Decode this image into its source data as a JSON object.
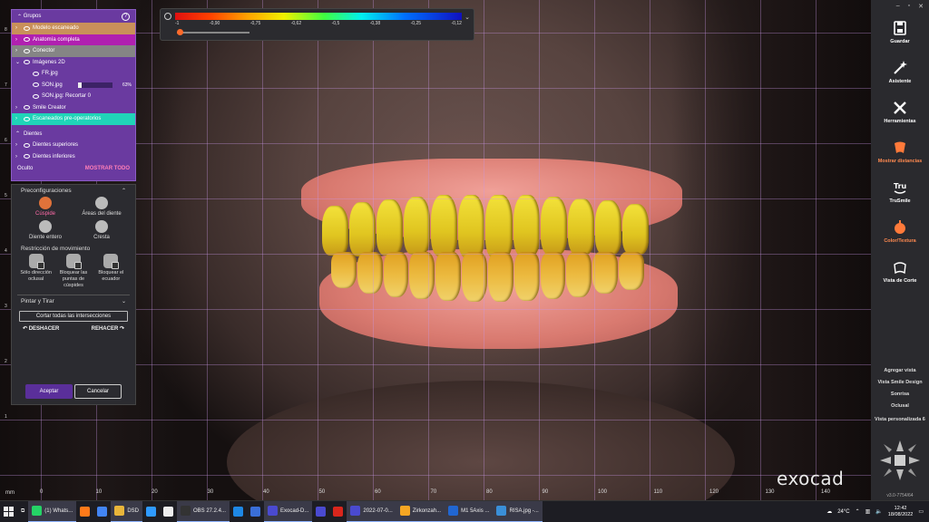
{
  "scale": {
    "labels": [
      "-1",
      "-0,90",
      "-0,75",
      "-0,62",
      "-0,5",
      "-0,38",
      "-0,25",
      "-0,12"
    ]
  },
  "groups": {
    "title": "Grupos",
    "rows": [
      {
        "label": "Modelo escaneado",
        "color": "#c9905a",
        "indent": 0,
        "chev": "›"
      },
      {
        "label": "Anatomía completa",
        "color": "#b020b0",
        "indent": 0,
        "chev": "›"
      },
      {
        "label": "Conector",
        "color": "#858585",
        "indent": 0,
        "chev": "›"
      },
      {
        "label": "Imágenes 2D",
        "color": "",
        "indent": 0,
        "chev": "⌄"
      },
      {
        "label": "FR.jpg",
        "color": "",
        "indent": 1,
        "chev": ""
      },
      {
        "label": "SON.jpg",
        "color": "",
        "indent": 1,
        "chev": "",
        "opacity": "63%"
      },
      {
        "label": "SON.jpg: Recortar 0",
        "color": "",
        "indent": 1,
        "chev": ""
      },
      {
        "label": "Smile Creator",
        "color": "",
        "indent": 0,
        "chev": "›"
      },
      {
        "label": "Escaneados pre-operatorios",
        "color": "#20d4b8",
        "indent": 0,
        "chev": "›"
      }
    ],
    "teeth_title": "Dientes",
    "teeth_rows": [
      "Dientes superiores",
      "Dientes inferiores"
    ],
    "hidden_label": "Oculto",
    "show_all": "MOSTRAR TODO"
  },
  "tools": {
    "presets_title": "Preconfiguraciones",
    "presets": [
      "Cúspide",
      "Áreas del diente",
      "Diente entero",
      "Cresta"
    ],
    "movement_title": "Restricción de movimiento",
    "movements": [
      "Sólo dirección oclusal",
      "Bloquear las puntas de cúspides",
      "Bloquear el ecuador"
    ],
    "paint_title": "Pintar y Tirar",
    "cut_all": "Cortar todas las intersecciones",
    "undo": "DESHACER",
    "redo": "REHACER",
    "accept": "Aceptar",
    "cancel": "Cancelar"
  },
  "ruler": {
    "unit": "mm",
    "ticks": [
      "0",
      "10",
      "20",
      "30",
      "40",
      "50",
      "60",
      "70",
      "80",
      "90",
      "100",
      "110",
      "120",
      "130",
      "140"
    ],
    "vticks": [
      "8",
      "7",
      "6",
      "5",
      "4",
      "3",
      "2",
      "1"
    ]
  },
  "brand": "exocad",
  "right_tools": [
    {
      "label": "Guardar",
      "icon": "save-icon",
      "orange": false
    },
    {
      "label": "Asistente",
      "icon": "wand-icon",
      "orange": false
    },
    {
      "label": "Herramientas",
      "icon": "tools-icon",
      "orange": false
    },
    {
      "label": "Mostrar distancias",
      "icon": "distance-icon",
      "orange": true
    },
    {
      "label": "TruSmile",
      "icon": "trusmile-icon",
      "orange": false
    },
    {
      "label": "Color/Textura",
      "icon": "palette-icon",
      "orange": true
    },
    {
      "label": "Vista de Corte",
      "icon": "cut-view-icon",
      "orange": false
    }
  ],
  "views": [
    "Agregar vista",
    "Vista Smile Design",
    "Sonrisa",
    "Oclusal",
    "Vista personalizada 6"
  ],
  "version": "v3.0-7754/64",
  "taskbar": {
    "items": [
      {
        "label": "(1) Whats...",
        "color": "#25d366"
      },
      {
        "label": "",
        "color": "#ff7a1a"
      },
      {
        "label": "",
        "color": "#4285f4"
      },
      {
        "label": "DSD",
        "color": "#e8b53a"
      },
      {
        "label": "",
        "color": "#2f9bff"
      },
      {
        "label": "",
        "color": "#eeeeee"
      },
      {
        "label": "OBS 27.2.4...",
        "color": "#333333"
      },
      {
        "label": "",
        "color": "#1e88e5"
      },
      {
        "label": "",
        "color": "#3a6fd8"
      },
      {
        "label": "Exocad-D...",
        "color": "#4a4ad0"
      },
      {
        "label": "",
        "color": "#4a4ad0"
      },
      {
        "label": "",
        "color": "#d9261c"
      },
      {
        "label": "2022-07-0...",
        "color": "#4a4ad0"
      },
      {
        "label": "Zirkonzah...",
        "color": "#f5a623"
      },
      {
        "label": "M1 5Axis ...",
        "color": "#2166d1"
      },
      {
        "label": "RISA.jpg -...",
        "color": "#3a8fd8"
      }
    ],
    "weather": "24°C",
    "time": "12:42",
    "date": "18/08/2022"
  }
}
